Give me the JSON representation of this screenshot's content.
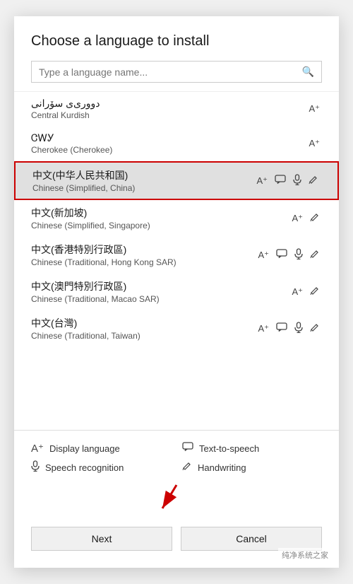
{
  "dialog": {
    "title": "Choose a language to install",
    "search_placeholder": "Type a language name..."
  },
  "languages": [
    {
      "name": "دووری‌ی سۆرانی",
      "sub": "Central Kurdish",
      "icons": [
        "A±"
      ],
      "selected": false
    },
    {
      "name": "ᏣᎳᎩ",
      "sub": "Cherokee (Cherokee)",
      "icons": [
        "A±"
      ],
      "selected": false
    },
    {
      "name": "中文(中华人民共和国)",
      "sub": "Chinese (Simplified, China)",
      "icons": [
        "A±",
        "💬",
        "🎤",
        "✏"
      ],
      "selected": true
    },
    {
      "name": "中文(新加坡)",
      "sub": "Chinese (Simplified, Singapore)",
      "icons": [
        "A±",
        "✏"
      ],
      "selected": false
    },
    {
      "name": "中文(香港特別行政區)",
      "sub": "Chinese (Traditional, Hong Kong SAR)",
      "icons": [
        "A±",
        "💬",
        "🎤",
        "✏"
      ],
      "selected": false
    },
    {
      "name": "中文(澳門特別行政區)",
      "sub": "Chinese (Traditional, Macao SAR)",
      "icons": [
        "A±",
        "✏"
      ],
      "selected": false
    },
    {
      "name": "中文(台灣)",
      "sub": "Chinese (Traditional, Taiwan)",
      "icons": [
        "A±",
        "💬",
        "🎤",
        "✏"
      ],
      "selected": false
    }
  ],
  "legend": [
    {
      "icon": "A±",
      "label": "Display language"
    },
    {
      "icon": "💬",
      "label": "Text-to-speech"
    },
    {
      "icon": "🎤",
      "label": "Speech recognition"
    },
    {
      "icon": "✏",
      "label": "Handwriting"
    }
  ],
  "buttons": {
    "next": "Next",
    "cancel": "Cancel"
  },
  "watermark": "纯净系统之家"
}
